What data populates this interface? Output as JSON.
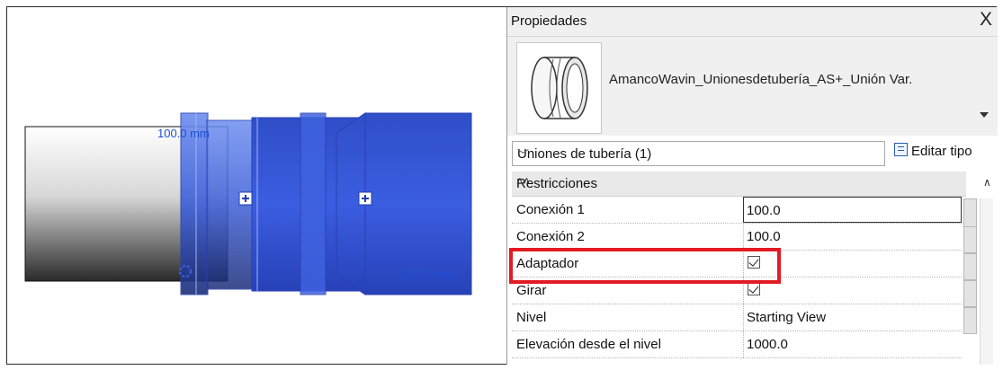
{
  "viewport": {
    "dim_label_top": "100.0 mm",
    "dim_label_right": "100.0 mm"
  },
  "properties": {
    "title": "Propiedades",
    "close_label": "X",
    "family_name": "AmancoWavin_Unionesdetubería_AS+_Unión Var.",
    "type_selector": "Uniones de tubería (1)",
    "edit_type_label": "Editar tipo",
    "section_label": "Restricciones",
    "rows": [
      {
        "name": "Conexión 1",
        "value": "100.0"
      },
      {
        "name": "Conexión 2",
        "value": "100.0"
      },
      {
        "name": "Adaptador",
        "checked": true
      },
      {
        "name": "Girar",
        "checked": true
      },
      {
        "name": "Nivel",
        "value": "Starting View"
      },
      {
        "name": "Elevación desde el nivel",
        "value": "1000.0"
      }
    ]
  },
  "colors": {
    "highlight": "#e21b23",
    "fitting_blue": "#3a5fe0",
    "dimension_blue": "#1f4fd6"
  }
}
